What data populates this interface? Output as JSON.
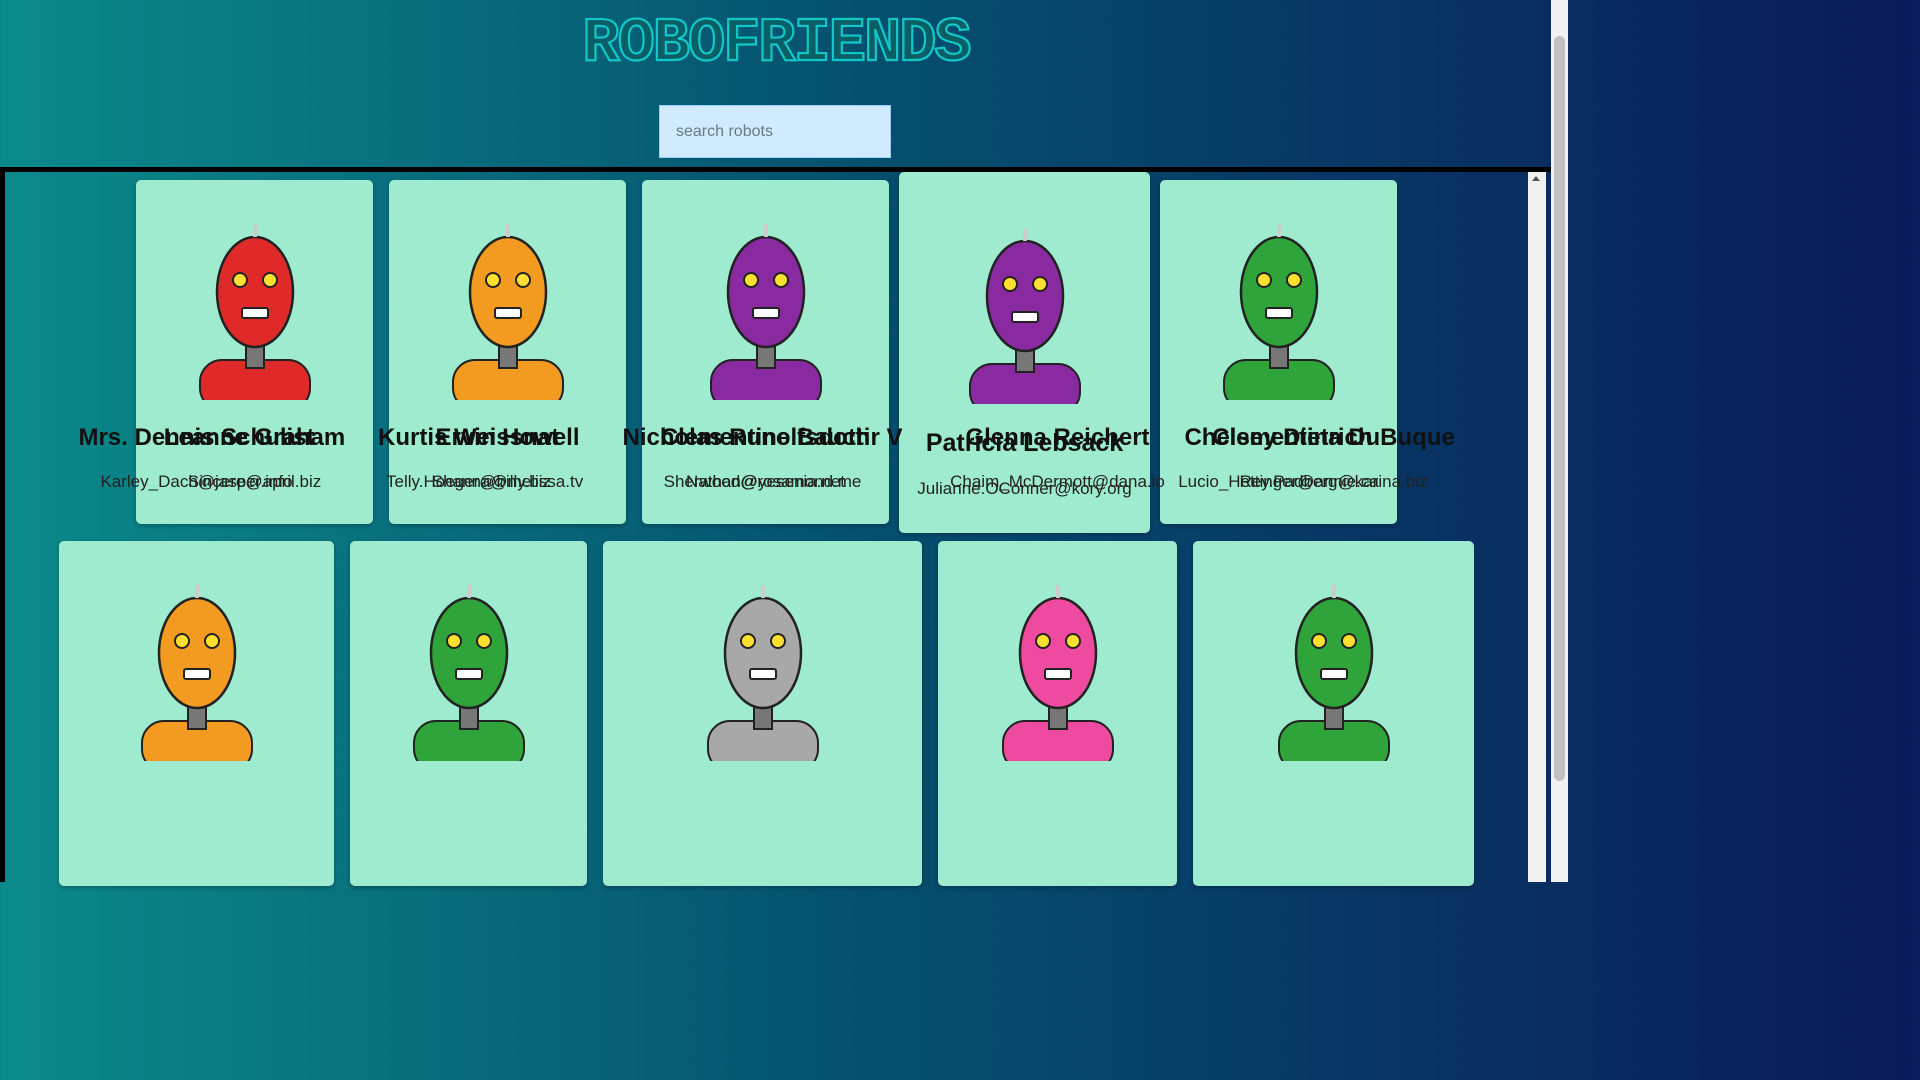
{
  "app": {
    "title": "ROBOFRIENDS",
    "search_placeholder": "search robots",
    "search_value": ""
  },
  "robots": [
    {
      "name": "Leanne Graham",
      "email": "Sincere@april.biz",
      "color": "#e02a2a"
    },
    {
      "name": "Ervin Howell",
      "email": "Shanna@melissa.tv",
      "color": "#f39a20"
    },
    {
      "name": "Clementine Bauch",
      "email": "Nathan@yesenia.net",
      "color": "#8a2aa0"
    },
    {
      "name": "Patricia Lebsack",
      "email": "Julianne.OConner@kory.org",
      "color": "#8a2aa0"
    },
    {
      "name": "Chelsey Dietrich",
      "email": "Lucio_Hettinger@annie.ca",
      "color": "#2fa43a"
    },
    {
      "name": "Mrs. Dennis Schulist",
      "email": "Karley_Dach@jasper.info",
      "color": "#f39a20"
    },
    {
      "name": "Kurtis Weissnat",
      "email": "Telly.Hoeger@billy.biz",
      "color": "#2fa43a"
    },
    {
      "name": "Nicholas Runolfsdottir V",
      "email": "Sherwood@rosamond.me",
      "color": "#a8a8a8"
    },
    {
      "name": "Glenna Reichert",
      "email": "Chaim_McDermott@dana.io",
      "color": "#ee4aa0"
    },
    {
      "name": "Clementina DuBuque",
      "email": "Rey.Padberg@karina.biz",
      "color": "#2fa43a"
    }
  ]
}
